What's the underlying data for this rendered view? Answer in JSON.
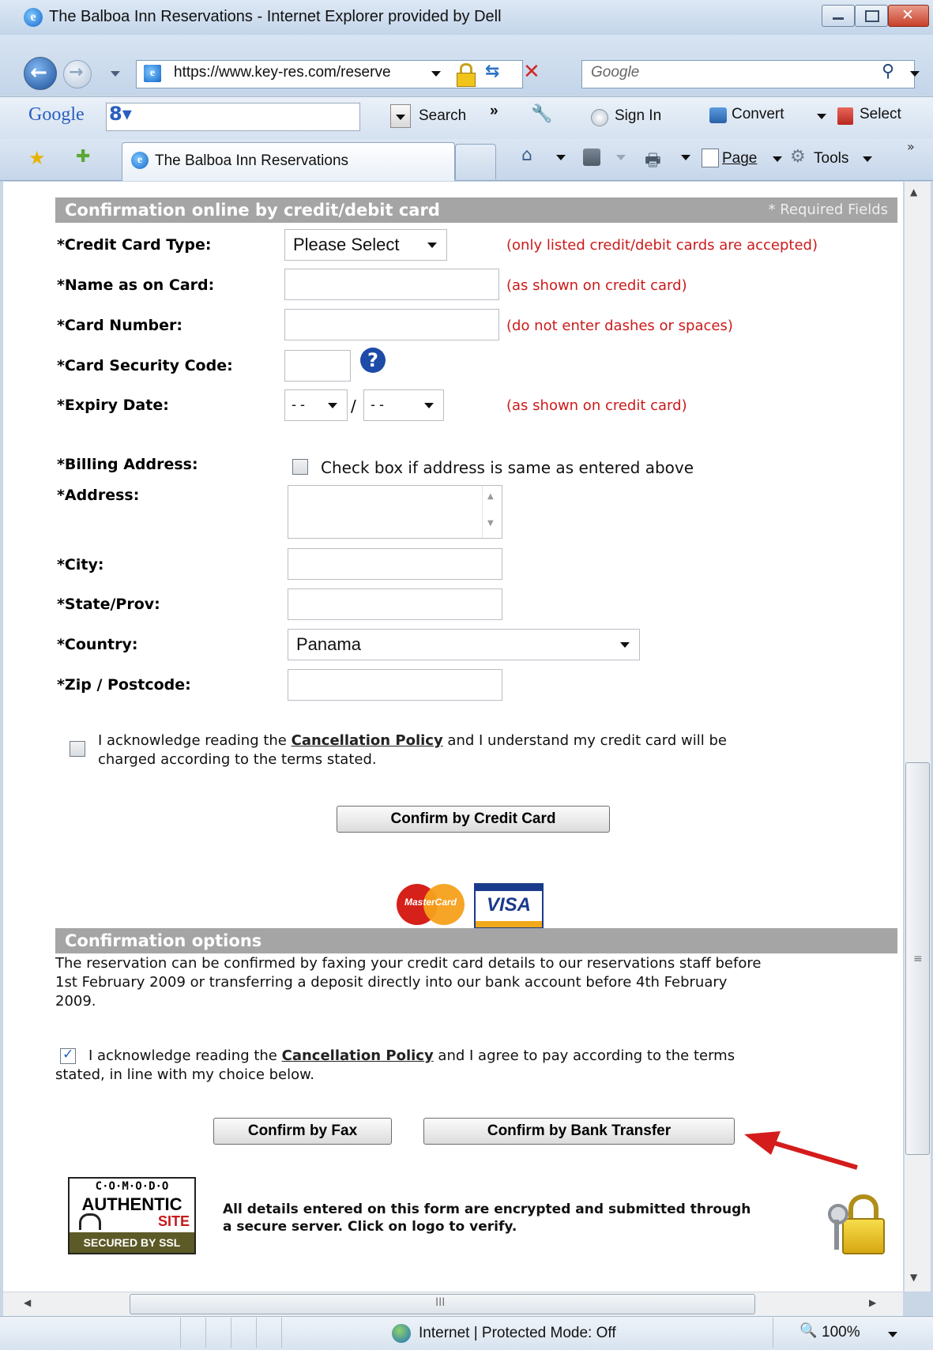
{
  "window": {
    "title": "The Balboa Inn Reservations - Internet Explorer provided by Dell"
  },
  "address_bar": {
    "url": "https://www.key-res.com/reserve",
    "search_placeholder": "Google"
  },
  "google_toolbar": {
    "logo": "Google",
    "search_label": "Search",
    "sign_in": "Sign In",
    "convert": "Convert",
    "select": "Select"
  },
  "tab": {
    "title": "The Balboa Inn Reservations"
  },
  "command_bar": {
    "page": "Page",
    "tools": "Tools"
  },
  "credit_section": {
    "header": "Confirmation online by credit/debit card",
    "required": "* Required Fields",
    "card_type": {
      "label": "*Credit Card Type:",
      "value": "Please Select",
      "hint": "(only listed credit/debit cards are accepted)"
    },
    "name": {
      "label": "*Name as on Card:",
      "hint": "(as shown on credit card)"
    },
    "number": {
      "label": "*Card Number:",
      "hint": "(do not enter dashes or spaces)"
    },
    "security": {
      "label": "*Card Security Code:"
    },
    "expiry": {
      "label": "*Expiry Date:",
      "month": "- -",
      "year": "- -",
      "separator": "/",
      "hint": "(as shown on credit card)"
    },
    "billing": {
      "label": "*Billing Address:",
      "checkbox": "Check box if address is same as entered above"
    },
    "address": {
      "label": "*Address:"
    },
    "city": {
      "label": "*City:"
    },
    "state": {
      "label": "*State/Prov:"
    },
    "country": {
      "label": "*Country:",
      "value": "Panama"
    },
    "zip": {
      "label": "*Zip / Postcode:"
    },
    "ack_pre": "I acknowledge reading the",
    "ack_link": "Cancellation Policy",
    "ack_post": "and I understand my credit card will be",
    "ack_line2": "charged according to the terms stated.",
    "confirm_button": "Confirm by Credit Card",
    "mastercard": "MasterCard",
    "visa": "VISA"
  },
  "options_section": {
    "header": "Confirmation options",
    "line1": "The reservation can be confirmed by faxing your credit card details to our reservations staff before",
    "line2": "1st February 2009 or transferring a deposit directly into our bank account before 4th February",
    "line3": "2009.",
    "ack_pre": "I acknowledge reading the",
    "ack_link": "Cancellation Policy",
    "ack_post": "and I agree to pay according to the terms",
    "ack_line2": "stated, in line with my choice below.",
    "ack_checked": true,
    "fax_button": "Confirm by Fax",
    "bank_button": "Confirm by Bank Transfer"
  },
  "security": {
    "comodo_line1": "C·O·M·O·D·O",
    "comodo_line2": "AUTHENTIC",
    "comodo_line3": "SITE",
    "comodo_line4": "SECURED BY SSL",
    "line1": "All details entered on this form are encrypted and submitted through",
    "line2": "a secure server. Click on logo to verify."
  },
  "status_bar": {
    "zone": "Internet | Protected Mode: Off",
    "zoom": "100%"
  },
  "colors": {
    "section_header": "#a5a5a5",
    "hint": "#cc1a1a",
    "arrow": "#d41c1c"
  }
}
